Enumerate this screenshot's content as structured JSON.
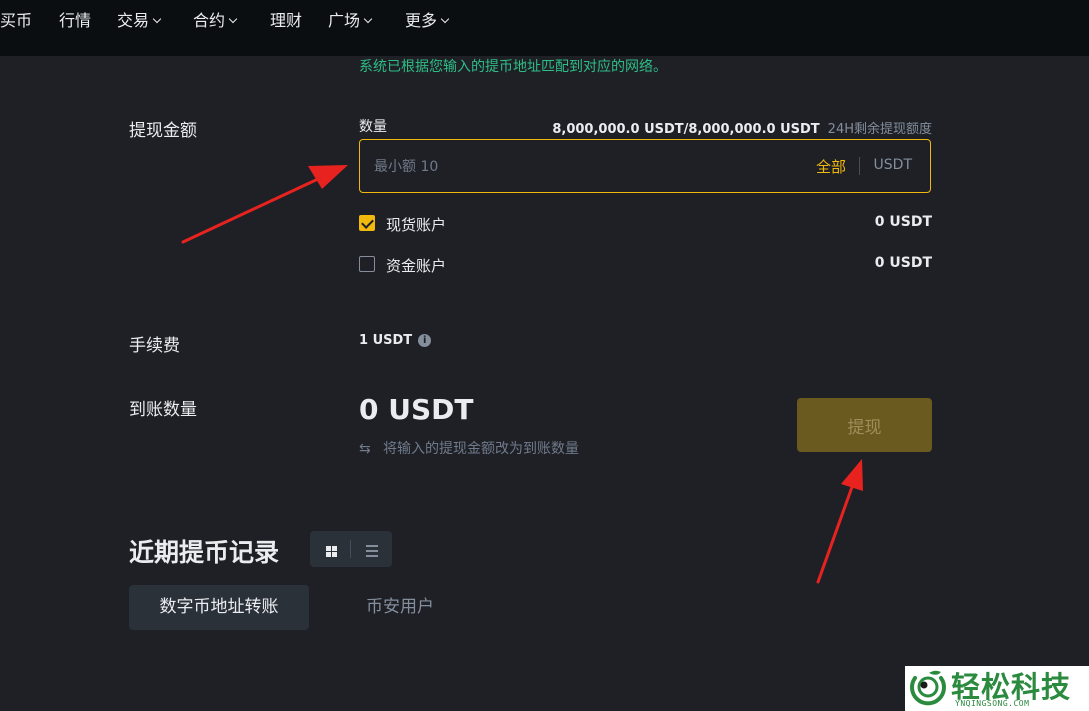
{
  "nav": {
    "items": [
      {
        "label": "买币",
        "has_dropdown": false
      },
      {
        "label": "行情",
        "has_dropdown": false
      },
      {
        "label": "交易",
        "has_dropdown": true
      },
      {
        "label": "合约",
        "has_dropdown": true
      },
      {
        "label": "理财",
        "has_dropdown": false
      },
      {
        "label": "广场",
        "has_dropdown": true
      },
      {
        "label": "更多",
        "has_dropdown": true
      }
    ]
  },
  "network_notice": "系统已根据您输入的提币地址匹配到对应的网络。",
  "withdraw_amount": {
    "section_label": "提现金额",
    "field_label": "数量",
    "quota_value": "8,000,000.0 USDT/8,000,000.0 USDT",
    "quota_desc": "24H剩余提现额度",
    "input_value": "",
    "input_placeholder": "最小额 10",
    "all_button": "全部",
    "unit": "USDT"
  },
  "accounts": [
    {
      "name": "现货账户",
      "balance": "0 USDT",
      "checked": true
    },
    {
      "name": "资金账户",
      "balance": "0 USDT",
      "checked": false
    }
  ],
  "fee": {
    "label": "手续费",
    "value": "1 USDT",
    "info_icon": "info-icon"
  },
  "receive": {
    "label": "到账数量",
    "value": "0 USDT",
    "switch_text": "将输入的提现金额改为到账数量",
    "switch_icon": "swap-icon"
  },
  "withdraw_button": "提现",
  "history": {
    "title": "近期提币记录",
    "view_icons": [
      "grid-view-icon",
      "list-view-icon"
    ],
    "tabs": [
      {
        "label": "数字币地址转账",
        "active": true
      },
      {
        "label": "币安用户",
        "active": false
      }
    ]
  },
  "watermark": {
    "text": "轻松科技",
    "sub": "YNQINGSONG.COM"
  },
  "colors": {
    "background": "#1e2026",
    "nav_background": "#0b0e11",
    "accent": "#f0b90b",
    "notice_green": "#2ebd85",
    "disabled_button": "#6a5a1f",
    "annotation_arrow": "#e8231f"
  }
}
